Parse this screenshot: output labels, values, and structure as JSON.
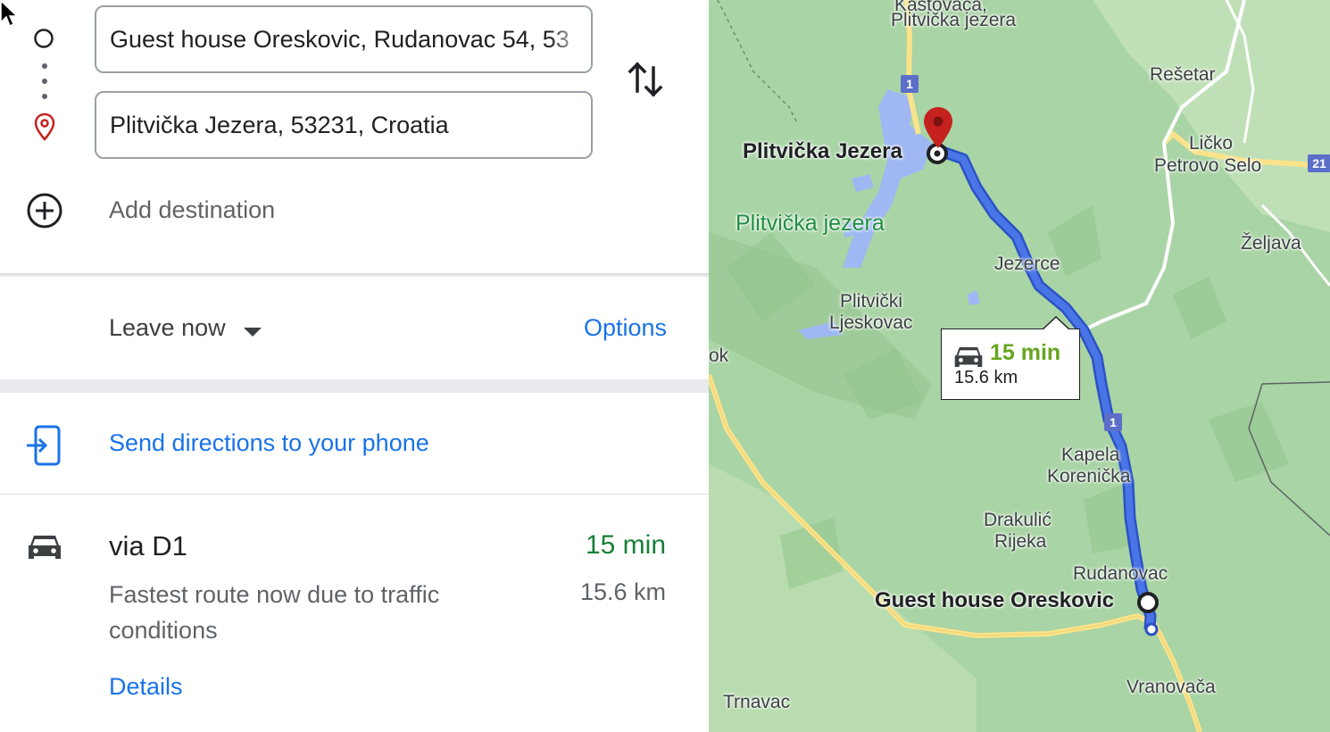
{
  "directions": {
    "origin_value": "Guest house Oreskovic, Rudanovac 54, 53",
    "destination_value": "Plitvička Jezera, 53231, Croatia",
    "add_destination_label": "Add destination",
    "swap_icon": "swap-vertical-icon"
  },
  "departure": {
    "leave_label": "Leave now",
    "options_label": "Options"
  },
  "send": {
    "label": "Send directions to your phone"
  },
  "route": {
    "name": "via D1",
    "description": "Fastest route now due to traffic conditions",
    "time": "15 min",
    "distance": "15.6 km",
    "details_label": "Details"
  },
  "map": {
    "labels": {
      "kastovaca": "Kaštovača,",
      "plitvicka_jezera_top": "Plitvička jezera",
      "resetar": "Rešetar",
      "licko_petrovo_selo_1": "Ličko",
      "licko_petrovo_selo_2": "Petrovo Selo",
      "plitvicka_jezera_dest": "Plitvička Jezera",
      "plitvicka_jezera_park": "Plitvička jezera",
      "zeljava": "Željava",
      "jezerce": "Jezerce",
      "plitvicki_1": "Plitvički",
      "plitvicki_2": "Ljeskovac",
      "ok": "ok",
      "kapela_1": "Kapela",
      "kapela_2": "Korenička",
      "drakulic_1": "Drakulić",
      "drakulic_2": "Rijeka",
      "rudanovac": "Rudanovac",
      "guest_house": "Guest house Oreskovic",
      "vranovaca": "Vranovača",
      "trnavac": "Trnavac"
    },
    "shields": {
      "d1_top": "1",
      "d1_mid": "1",
      "road_21": "21"
    },
    "popup": {
      "time": "15 min",
      "distance": "15.6 km"
    },
    "colors": {
      "route": "#4a75e6",
      "route_outline": "#2b52c5",
      "forest": "#a9d4a5",
      "lake": "#9fb8f3",
      "highway": "#fbe38a",
      "destination_pin": "#c5221f"
    }
  }
}
